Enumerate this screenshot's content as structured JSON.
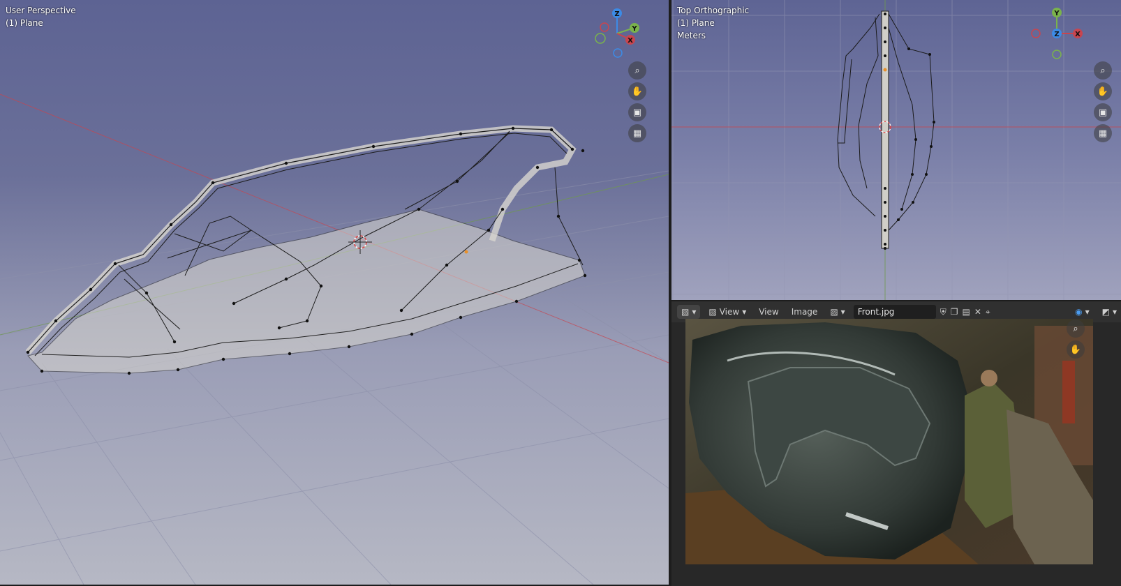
{
  "viewport_perspective": {
    "view_name": "User Perspective",
    "object_label": "(1) Plane",
    "gizmo": {
      "z": "Z",
      "y": "Y",
      "x": "X"
    },
    "nav_icons": [
      "zoom-icon",
      "hand-pan-icon",
      "camera-icon",
      "perspective-grid-icon"
    ]
  },
  "viewport_top": {
    "view_name": "Top Orthographic",
    "object_label": "(1) Plane",
    "units": "Meters",
    "gizmo": {
      "y": "Y",
      "z": "Z",
      "x": "X"
    },
    "nav_icons": [
      "zoom-icon",
      "hand-pan-icon",
      "camera-icon",
      "ortho-grid-icon"
    ]
  },
  "image_editor": {
    "header": {
      "view_menu_label": "View",
      "view_label": "View",
      "image_label": "Image",
      "image_name": "Front.jpg"
    },
    "nav_icons": [
      "zoom-icon",
      "hand-pan-icon"
    ]
  },
  "colors": {
    "x_axis": "#c8454f",
    "y_axis": "#7ab34c",
    "z_axis": "#3c8be6"
  }
}
